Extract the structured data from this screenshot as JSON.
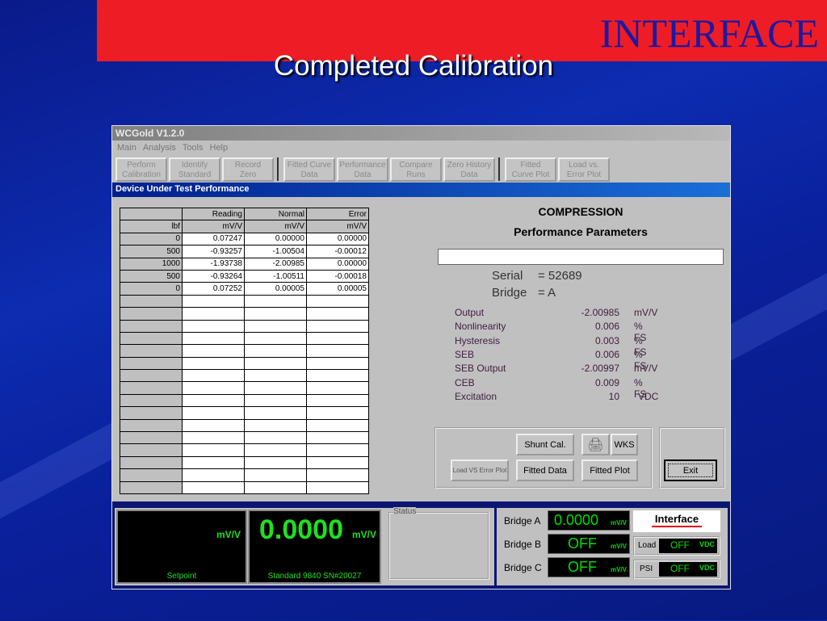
{
  "slide": {
    "brand": "INTERFACE",
    "title": "Completed Calibration"
  },
  "window": {
    "title": "WCGold  V1.2.0",
    "menu": [
      "Main",
      "Analysis",
      "Tools",
      "Help"
    ],
    "toolbar": [
      [
        "Perform",
        "Calibration"
      ],
      [
        "Identify",
        "Standard"
      ],
      [
        "Record",
        "Zero"
      ],
      [
        "Fitted Curve",
        "Data"
      ],
      [
        "Performance",
        "Data"
      ],
      [
        "Compare",
        "Runs"
      ],
      [
        "Zero History",
        "Data"
      ],
      [
        "Fitted",
        "Curve Plot"
      ],
      [
        "Load vs.",
        "Error Plot"
      ]
    ],
    "section_title": "Device Under Test  Performance"
  },
  "table": {
    "headers": [
      "",
      "Reading",
      "Normal",
      "Error"
    ],
    "units": [
      "lbf",
      "mV/V",
      "mV/V",
      "mV/V"
    ],
    "rows": [
      [
        "0",
        "0.07247",
        "0.00000",
        "0.00000"
      ],
      [
        "500",
        "-0.93257",
        "-1.00504",
        "-0.00012"
      ],
      [
        "1000",
        "-1.93738",
        "-2.00985",
        "0.00000"
      ],
      [
        "500",
        "-0.93264",
        "-1.00511",
        "-0.00018"
      ],
      [
        "0",
        "0.07252",
        "0.00005",
        "0.00005"
      ]
    ]
  },
  "performance": {
    "mode": "COMPRESSION",
    "heading": "Performance Parameters",
    "input_value": "",
    "serial_label": "Serial",
    "serial": "= 52689",
    "bridge_label": "Bridge",
    "bridge": "= A",
    "params": [
      [
        "Output",
        "-2.00985",
        "mV/V"
      ],
      [
        "Nonlinearity",
        "0.006",
        "% FS"
      ],
      [
        "Hysteresis",
        "0.003",
        "% FS"
      ],
      [
        "SEB",
        "0.006",
        "% FS"
      ],
      [
        "SEB Output",
        "-2.00997",
        "mV/V"
      ],
      [
        "CEB",
        "0.009",
        "% FS"
      ],
      [
        "Excitation",
        "10",
        "VDC"
      ]
    ]
  },
  "buttons": {
    "shunt": "Shunt Cal.",
    "wks": "WKS",
    "load_vs_error": "Load VS Error Plot",
    "fitted_data": "Fitted Data",
    "fitted_plot": "Fitted Plot",
    "exit": "Exit"
  },
  "status_bar": {
    "setpoint_unit": "mV/V",
    "setpoint_label": "Setpoint",
    "standard_value": "0.0000",
    "standard_unit": "mV/V",
    "standard_label": "Standard 9840 SN#20027",
    "status_label": "Status",
    "bridges": [
      {
        "label": "Bridge A",
        "value": "0.0000",
        "unit": "mV/V"
      },
      {
        "label": "Bridge B",
        "value": "OFF",
        "unit": "mV/V"
      },
      {
        "label": "Bridge C",
        "value": "OFF",
        "unit": "mV/V"
      }
    ],
    "logo": "Interface",
    "load": {
      "label": "Load",
      "value": "OFF",
      "unit": "VDC"
    },
    "psi": {
      "label": "PSI",
      "value": "OFF",
      "unit": "VDC"
    }
  }
}
